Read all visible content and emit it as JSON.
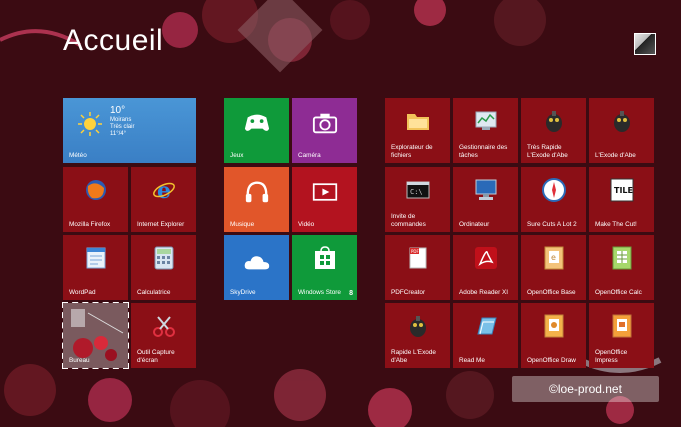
{
  "screen": {
    "title": "Accueil"
  },
  "user": {
    "avatar_icon": "user-avatar"
  },
  "tiles": {
    "weather": {
      "label": "Météo",
      "temp": "10°",
      "city": "Moirans",
      "condition": "Très clair",
      "range": "11°/4°"
    },
    "jeux": {
      "label": "Jeux"
    },
    "camera": {
      "label": "Caméra"
    },
    "firefox": {
      "label": "Mozilla Firefox"
    },
    "ie": {
      "label": "Internet Explorer"
    },
    "musique": {
      "label": "Musique"
    },
    "video": {
      "label": "Vidéo"
    },
    "wordpad": {
      "label": "WordPad"
    },
    "calculatrice": {
      "label": "Calculatrice"
    },
    "skydrive": {
      "label": "SkyDrive"
    },
    "store": {
      "label": "Windows Store",
      "badge": "8"
    },
    "photo": {
      "label": "Bureau"
    },
    "capture": {
      "label": "Outil Capture d'écran"
    },
    "explorateur": {
      "label": "Explorateur de fichiers"
    },
    "gestionnaire": {
      "label": "Gestionnaire des tâches"
    },
    "tres_rapide": {
      "label": "Très Rapide L'Exode d'Abe"
    },
    "exode": {
      "label": "L'Exode d'Abe"
    },
    "invite": {
      "label": "Invite de commandes"
    },
    "ordinateur": {
      "label": "Ordinateur"
    },
    "sure_cuts": {
      "label": "Sure Cuts A Lot 2"
    },
    "make_the_cut": {
      "label": "Make The Cut!"
    },
    "pdfcreator": {
      "label": "PDFCreator"
    },
    "adobe": {
      "label": "Adobe Reader XI"
    },
    "oo_base": {
      "label": "OpenOffice Base"
    },
    "oo_calc": {
      "label": "OpenOffice Calc"
    },
    "rapide_exode": {
      "label": "Rapide L'Exode d'Abe"
    },
    "readme": {
      "label": "Read Me"
    },
    "oo_draw": {
      "label": "OpenOffice Draw"
    },
    "oo_impress": {
      "label": "OpenOffice Impress"
    }
  },
  "watermark": {
    "text": "©loe-prod.net"
  }
}
